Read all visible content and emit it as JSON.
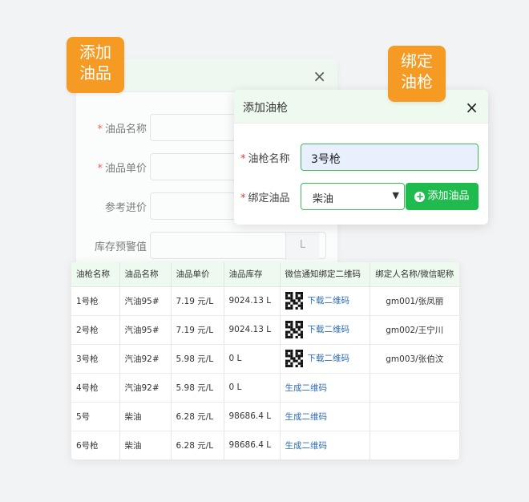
{
  "badges": {
    "add_product": "添加\n油品",
    "bind_nozzle": "绑定\n油枪"
  },
  "back_dialog": {
    "close": "×",
    "fields": [
      {
        "label": "油品名称",
        "required": true
      },
      {
        "label": "油品单价",
        "required": true
      },
      {
        "label": "参考进价",
        "required": false
      },
      {
        "label": "库存预警值",
        "required": false,
        "unit": "L"
      }
    ]
  },
  "front_dialog": {
    "title": "添加油枪",
    "close": "×",
    "nozzle_name_label": "油枪名称",
    "nozzle_name_value": "3号枪",
    "product_label": "绑定油品",
    "product_selected": "柴油",
    "add_product_button": "添加油品"
  },
  "table": {
    "columns": [
      "油枪名称",
      "油品名称",
      "油品单价",
      "油品库存",
      "微信通知绑定二维码",
      "绑定人名称/微信昵称"
    ],
    "rows": [
      {
        "nozzle": "1号枪",
        "product": "汽油95#",
        "price": "7.19 元/L",
        "stock": "9024.13 L",
        "qr": true,
        "action": "下载二维码",
        "binder": "gm001/张凤丽"
      },
      {
        "nozzle": "2号枪",
        "product": "汽油95#",
        "price": "7.19 元/L",
        "stock": "9024.13 L",
        "qr": true,
        "action": "下载二维码",
        "binder": "gm002/王宁川"
      },
      {
        "nozzle": "3号枪",
        "product": "汽油92#",
        "price": "5.98 元/L",
        "stock": "0 L",
        "qr": true,
        "action": "下载二维码",
        "binder": "gm003/张伯汶"
      },
      {
        "nozzle": "4号枪",
        "product": "汽油92#",
        "price": "5.98 元/L",
        "stock": "0 L",
        "qr": false,
        "action": "生成二维码",
        "binder": ""
      },
      {
        "nozzle": "5号",
        "product": "柴油",
        "price": "6.28 元/L",
        "stock": "98686.4 L",
        "qr": false,
        "action": "生成二维码",
        "binder": ""
      },
      {
        "nozzle": "6号枪",
        "product": "柴油",
        "price": "6.28 元/L",
        "stock": "98686.4 L",
        "qr": false,
        "action": "生成二维码",
        "binder": ""
      }
    ]
  },
  "colors": {
    "accent_green": "#1fbb4f",
    "badge_orange": "#f59a23",
    "link_blue": "#2f6db5",
    "header_green": "#eef9f0"
  }
}
